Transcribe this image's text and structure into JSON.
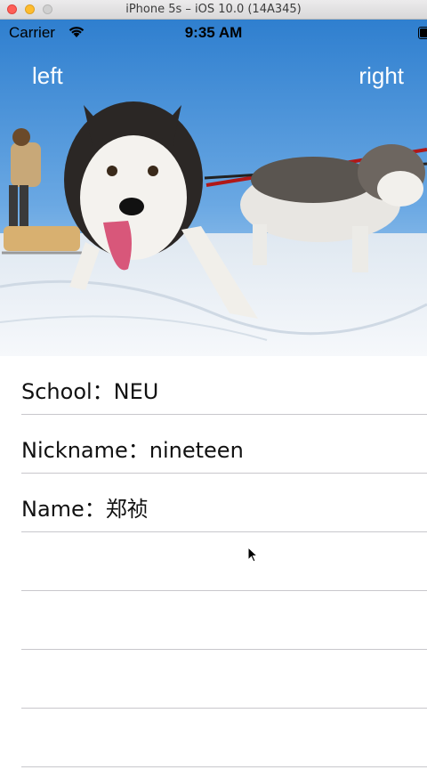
{
  "window": {
    "title": "iPhone 5s – iOS 10.0 (14A345)"
  },
  "status_bar": {
    "carrier": "Carrier",
    "time": "9:35 AM"
  },
  "nav": {
    "left_label": "left",
    "right_label": "right"
  },
  "header_image": {
    "subject": "husky dogs pulling a sled on snow"
  },
  "table": {
    "rows": [
      {
        "text": "School：NEU"
      },
      {
        "text": "Nickname：nineteen"
      },
      {
        "text": "Name：郑祯"
      },
      {
        "text": ""
      },
      {
        "text": ""
      },
      {
        "text": ""
      },
      {
        "text": ""
      }
    ]
  },
  "icons": [
    "wifi-icon",
    "battery-icon",
    "mouse-cursor-icon"
  ]
}
